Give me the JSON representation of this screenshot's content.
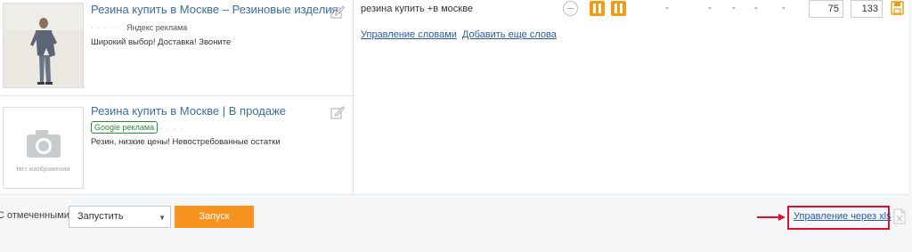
{
  "ads": [
    {
      "title": "Резина купить в Москве – Резиновые изделия.",
      "badge": "Яндекс реклама",
      "badge_dots": "· · · · ·",
      "description": "Широкий выбор! Доставка! Звоните",
      "has_photo": true
    },
    {
      "title": "Резина купить в Москве | В продаже",
      "badge": "Google реклама",
      "badge_dots": "· · · · ·",
      "description": "Резин, низкие цены! Невостребованные остатки",
      "no_image_text": "Нет изображения",
      "has_photo": false
    }
  ],
  "keyword": {
    "text": "резина купить +в москве",
    "dashes": [
      "-",
      "-",
      "-",
      "-",
      "-"
    ],
    "value_1": "75",
    "value_2": "133"
  },
  "keyword_links": {
    "manage": "Управление словами",
    "add": "Добавить еще слова"
  },
  "bottom": {
    "select_label": "С отмеченными:",
    "select_value": "Запустить",
    "run_button": "Запуск",
    "xls_link": "Управление через xls"
  },
  "colors": {
    "accent_orange": "#f7931e",
    "link_blue": "#2b5aa0",
    "highlight_red": "#e0102a",
    "google_green": "#2d8c3a"
  }
}
